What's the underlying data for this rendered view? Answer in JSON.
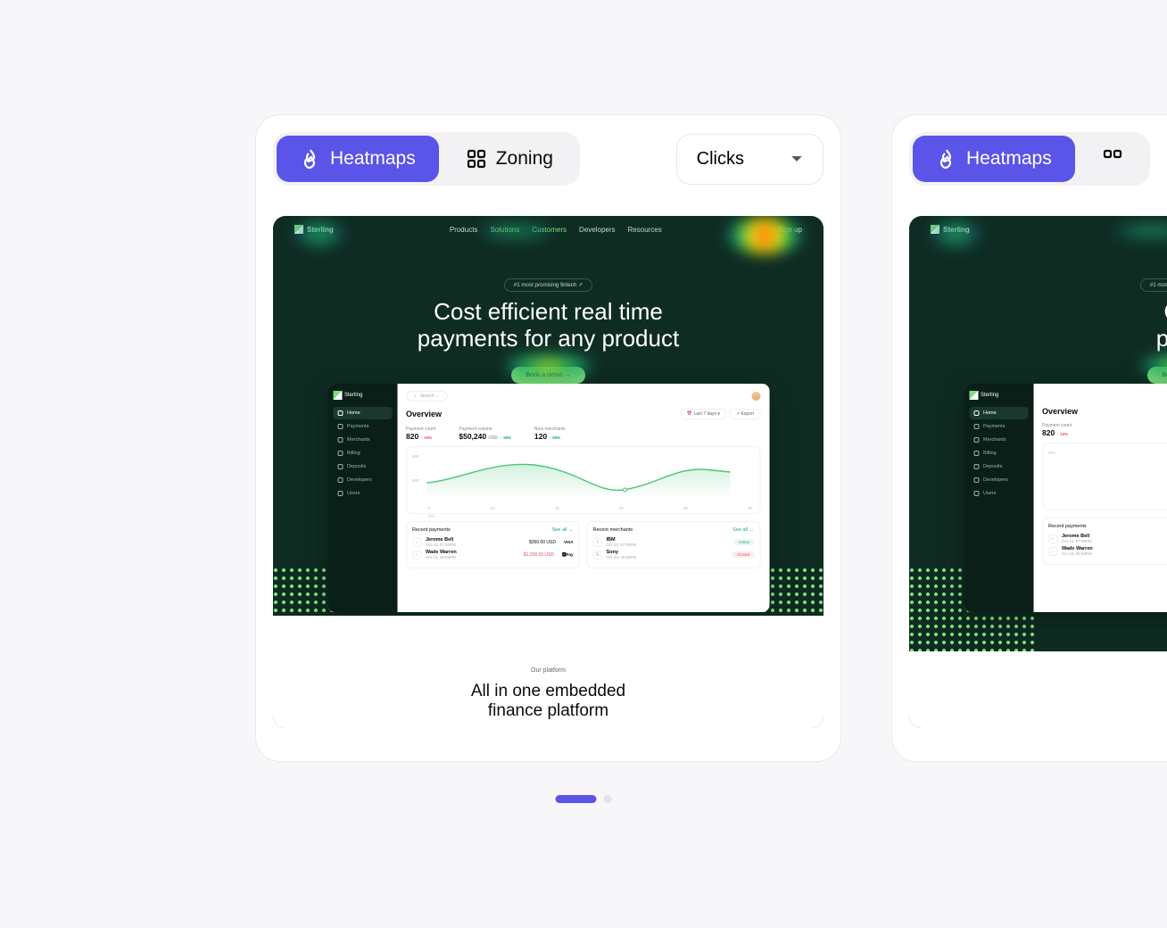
{
  "toolbar": {
    "heatmaps": "Heatmaps",
    "zoning": "Zoning",
    "dropdown": "Clicks"
  },
  "site": {
    "brand": "Sterling",
    "nav": [
      "Products",
      "Solutions",
      "Customers",
      "Developers",
      "Resources"
    ],
    "signup": "Sign up",
    "pill": "#1 most promising fintech  ↗",
    "hero": "Cost efficient real time payments for any product",
    "cta": "Book a demo →",
    "our_platform": "Our platform",
    "subtitle": "All in one embedded finance platform"
  },
  "dashboard": {
    "sidebar": [
      "Home",
      "Payments",
      "Merchants",
      "Billing",
      "Deposits",
      "Developers",
      "Users"
    ],
    "search": "Search ...",
    "title": "Overview",
    "range": "Last 7 days",
    "export": "Export",
    "metrics": {
      "count_label": "Payment count",
      "count": "820",
      "count_d": "↓ 10%",
      "vol_label": "Payment volume",
      "vol": "$50,240",
      "vol_cur": "USD",
      "vol_d": "↑ 18%",
      "mer_label": "New merchants",
      "mer": "120",
      "mer_d": "↑ 29%"
    },
    "chart_ylabels": [
      "900",
      "500"
    ],
    "chart_xlabels": [
      "5",
      "10",
      "15",
      "20",
      "25",
      "30"
    ],
    "chart_month": "Oct",
    "recent_payments": {
      "title": "Recent payments",
      "see": "See all →",
      "rows": [
        {
          "name": "Jerome Bell",
          "date": "Oct 23, 07:00PM",
          "amt": "$360.00 USD",
          "brand": "VISA"
        },
        {
          "name": "Wade Warren",
          "date": "Oct 23, 08:59PM",
          "amt": "$1,268.00 USD",
          "brand": "🅿Pay",
          "neg": true
        }
      ]
    },
    "recent_merchants": {
      "title": "Recent merchants",
      "see": "See all →",
      "rows": [
        {
          "name": "IBM",
          "date": "Oct 23, 07:00PM",
          "status": "Active",
          "cls": "g"
        },
        {
          "name": "Sony",
          "date": "Oct 23, 06:50PM",
          "status": "Closed",
          "cls": "r"
        }
      ]
    }
  },
  "chart_data": {
    "type": "line",
    "x": [
      5,
      10,
      15,
      20,
      25,
      30
    ],
    "values": [
      620,
      820,
      760,
      480,
      790,
      760
    ],
    "ylim": [
      400,
      900
    ]
  }
}
